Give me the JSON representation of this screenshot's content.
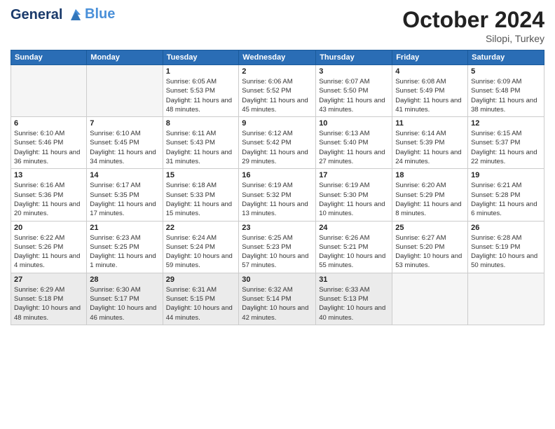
{
  "header": {
    "logo_line1": "General",
    "logo_line2": "Blue",
    "month": "October 2024",
    "location": "Silopi, Turkey"
  },
  "weekdays": [
    "Sunday",
    "Monday",
    "Tuesday",
    "Wednesday",
    "Thursday",
    "Friday",
    "Saturday"
  ],
  "weeks": [
    [
      {
        "day": "",
        "info": ""
      },
      {
        "day": "",
        "info": ""
      },
      {
        "day": "1",
        "info": "Sunrise: 6:05 AM\nSunset: 5:53 PM\nDaylight: 11 hours and 48 minutes."
      },
      {
        "day": "2",
        "info": "Sunrise: 6:06 AM\nSunset: 5:52 PM\nDaylight: 11 hours and 45 minutes."
      },
      {
        "day": "3",
        "info": "Sunrise: 6:07 AM\nSunset: 5:50 PM\nDaylight: 11 hours and 43 minutes."
      },
      {
        "day": "4",
        "info": "Sunrise: 6:08 AM\nSunset: 5:49 PM\nDaylight: 11 hours and 41 minutes."
      },
      {
        "day": "5",
        "info": "Sunrise: 6:09 AM\nSunset: 5:48 PM\nDaylight: 11 hours and 38 minutes."
      }
    ],
    [
      {
        "day": "6",
        "info": "Sunrise: 6:10 AM\nSunset: 5:46 PM\nDaylight: 11 hours and 36 minutes."
      },
      {
        "day": "7",
        "info": "Sunrise: 6:10 AM\nSunset: 5:45 PM\nDaylight: 11 hours and 34 minutes."
      },
      {
        "day": "8",
        "info": "Sunrise: 6:11 AM\nSunset: 5:43 PM\nDaylight: 11 hours and 31 minutes."
      },
      {
        "day": "9",
        "info": "Sunrise: 6:12 AM\nSunset: 5:42 PM\nDaylight: 11 hours and 29 minutes."
      },
      {
        "day": "10",
        "info": "Sunrise: 6:13 AM\nSunset: 5:40 PM\nDaylight: 11 hours and 27 minutes."
      },
      {
        "day": "11",
        "info": "Sunrise: 6:14 AM\nSunset: 5:39 PM\nDaylight: 11 hours and 24 minutes."
      },
      {
        "day": "12",
        "info": "Sunrise: 6:15 AM\nSunset: 5:37 PM\nDaylight: 11 hours and 22 minutes."
      }
    ],
    [
      {
        "day": "13",
        "info": "Sunrise: 6:16 AM\nSunset: 5:36 PM\nDaylight: 11 hours and 20 minutes."
      },
      {
        "day": "14",
        "info": "Sunrise: 6:17 AM\nSunset: 5:35 PM\nDaylight: 11 hours and 17 minutes."
      },
      {
        "day": "15",
        "info": "Sunrise: 6:18 AM\nSunset: 5:33 PM\nDaylight: 11 hours and 15 minutes."
      },
      {
        "day": "16",
        "info": "Sunrise: 6:19 AM\nSunset: 5:32 PM\nDaylight: 11 hours and 13 minutes."
      },
      {
        "day": "17",
        "info": "Sunrise: 6:19 AM\nSunset: 5:30 PM\nDaylight: 11 hours and 10 minutes."
      },
      {
        "day": "18",
        "info": "Sunrise: 6:20 AM\nSunset: 5:29 PM\nDaylight: 11 hours and 8 minutes."
      },
      {
        "day": "19",
        "info": "Sunrise: 6:21 AM\nSunset: 5:28 PM\nDaylight: 11 hours and 6 minutes."
      }
    ],
    [
      {
        "day": "20",
        "info": "Sunrise: 6:22 AM\nSunset: 5:26 PM\nDaylight: 11 hours and 4 minutes."
      },
      {
        "day": "21",
        "info": "Sunrise: 6:23 AM\nSunset: 5:25 PM\nDaylight: 11 hours and 1 minute."
      },
      {
        "day": "22",
        "info": "Sunrise: 6:24 AM\nSunset: 5:24 PM\nDaylight: 10 hours and 59 minutes."
      },
      {
        "day": "23",
        "info": "Sunrise: 6:25 AM\nSunset: 5:23 PM\nDaylight: 10 hours and 57 minutes."
      },
      {
        "day": "24",
        "info": "Sunrise: 6:26 AM\nSunset: 5:21 PM\nDaylight: 10 hours and 55 minutes."
      },
      {
        "day": "25",
        "info": "Sunrise: 6:27 AM\nSunset: 5:20 PM\nDaylight: 10 hours and 53 minutes."
      },
      {
        "day": "26",
        "info": "Sunrise: 6:28 AM\nSunset: 5:19 PM\nDaylight: 10 hours and 50 minutes."
      }
    ],
    [
      {
        "day": "27",
        "info": "Sunrise: 6:29 AM\nSunset: 5:18 PM\nDaylight: 10 hours and 48 minutes."
      },
      {
        "day": "28",
        "info": "Sunrise: 6:30 AM\nSunset: 5:17 PM\nDaylight: 10 hours and 46 minutes."
      },
      {
        "day": "29",
        "info": "Sunrise: 6:31 AM\nSunset: 5:15 PM\nDaylight: 10 hours and 44 minutes."
      },
      {
        "day": "30",
        "info": "Sunrise: 6:32 AM\nSunset: 5:14 PM\nDaylight: 10 hours and 42 minutes."
      },
      {
        "day": "31",
        "info": "Sunrise: 6:33 AM\nSunset: 5:13 PM\nDaylight: 10 hours and 40 minutes."
      },
      {
        "day": "",
        "info": ""
      },
      {
        "day": "",
        "info": ""
      }
    ]
  ]
}
